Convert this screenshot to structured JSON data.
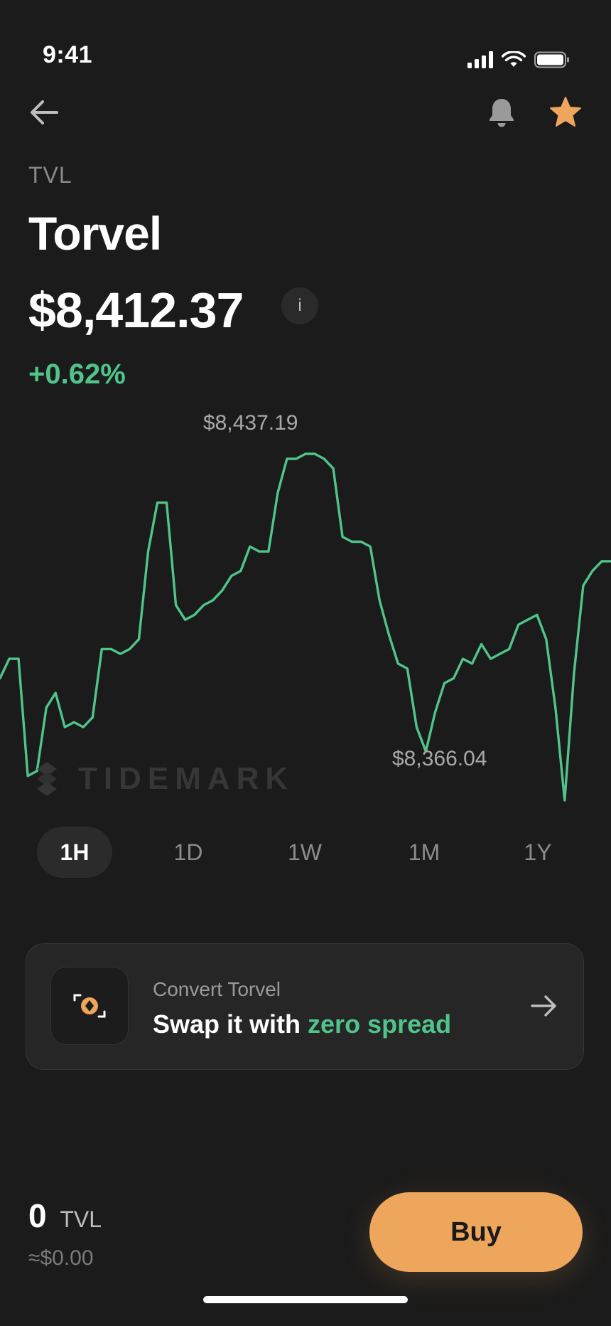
{
  "status_bar": {
    "time": "9:41"
  },
  "asset": {
    "ticker": "TVL",
    "name": "Torvel",
    "price": "$8,412.37",
    "info_label": "i",
    "change": "+0.62%"
  },
  "chart": {
    "high_label": "$8,437.19",
    "low_label": "$8,366.04",
    "line_color": "#4fc58b",
    "watermark": "TIDEMARK"
  },
  "chart_data": {
    "type": "line",
    "series": [
      {
        "values": [
          8391,
          8395,
          8395,
          8371,
          8372,
          8385,
          8388,
          8381,
          8382,
          8381,
          8383,
          8397,
          8397,
          8396,
          8397,
          8399,
          8417,
          8427,
          8427,
          8406,
          8403,
          8404,
          8406,
          8407,
          8409,
          8412,
          8413,
          8418,
          8417,
          8417,
          8429,
          8436,
          8436,
          8437,
          8437,
          8436,
          8434,
          8420,
          8419,
          8419,
          8418,
          8407,
          8400,
          8394,
          8393,
          8381,
          8376,
          8384,
          8390,
          8391,
          8395,
          8394,
          8398,
          8395,
          8396,
          8397,
          8402,
          8403,
          8404,
          8399,
          8385,
          8366,
          8392,
          8410,
          8413,
          8415,
          8415
        ]
      }
    ],
    "annotations": [
      "$8,437.19",
      "$8,366.04"
    ]
  },
  "range_tabs": [
    {
      "label": "1H",
      "active": true
    },
    {
      "label": "1D",
      "active": false
    },
    {
      "label": "1W",
      "active": false
    },
    {
      "label": "1M",
      "active": false
    },
    {
      "label": "1Y",
      "active": false
    }
  ],
  "convert_card": {
    "subtitle": "Convert Torvel",
    "title_prefix": "Swap it with",
    "title_accent": "zero spread"
  },
  "holdings": {
    "amount": "0",
    "unit": "TVL",
    "fiat": "≈$0.00"
  },
  "buy_button": {
    "label": "Buy"
  },
  "colors": {
    "background": "#1b1b1b",
    "positive": "#4fc58b",
    "accent": "#eda65c"
  }
}
